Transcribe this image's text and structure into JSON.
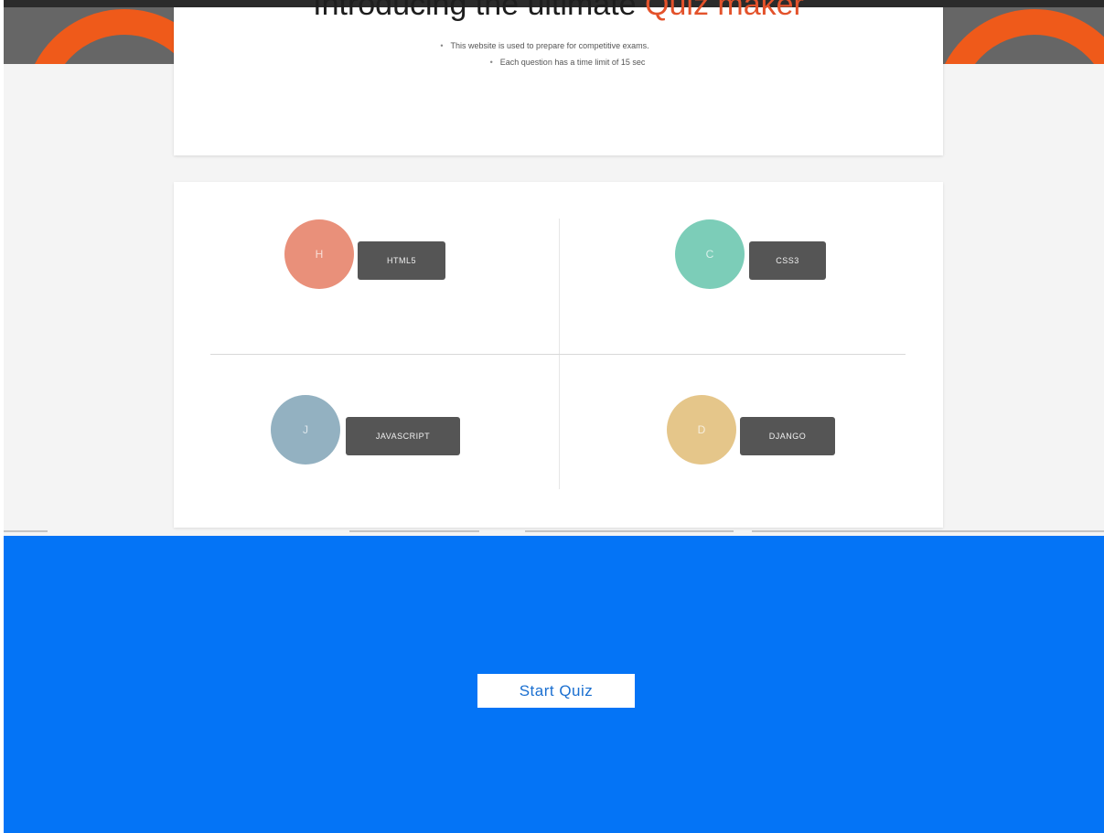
{
  "header": {
    "title_prefix": "Introducing the ultimate ",
    "title_accent": "Quiz maker",
    "bullets": [
      "This website is used to prepare for competitive exams.",
      "Each question has a time limit of 15 sec"
    ]
  },
  "topics": [
    {
      "label": "HTML5",
      "icon": "html5-icon",
      "glyph": "H",
      "color": "#e9907a"
    },
    {
      "label": "CSS3",
      "icon": "css3-icon",
      "glyph": "C",
      "color": "#7ccdb8"
    },
    {
      "label": "JAVASCRIPT",
      "icon": "javascript-icon",
      "glyph": "J",
      "color": "#93b1c1"
    },
    {
      "label": "DJANGO",
      "icon": "django-icon",
      "glyph": "D",
      "color": "#e5c68a"
    }
  ],
  "colors": {
    "accent": "#e3522b",
    "banner_ring": "#ef5a1a",
    "panel": "#0474f6",
    "button_dark": "#555555"
  },
  "start": {
    "label": "Start Quiz"
  }
}
